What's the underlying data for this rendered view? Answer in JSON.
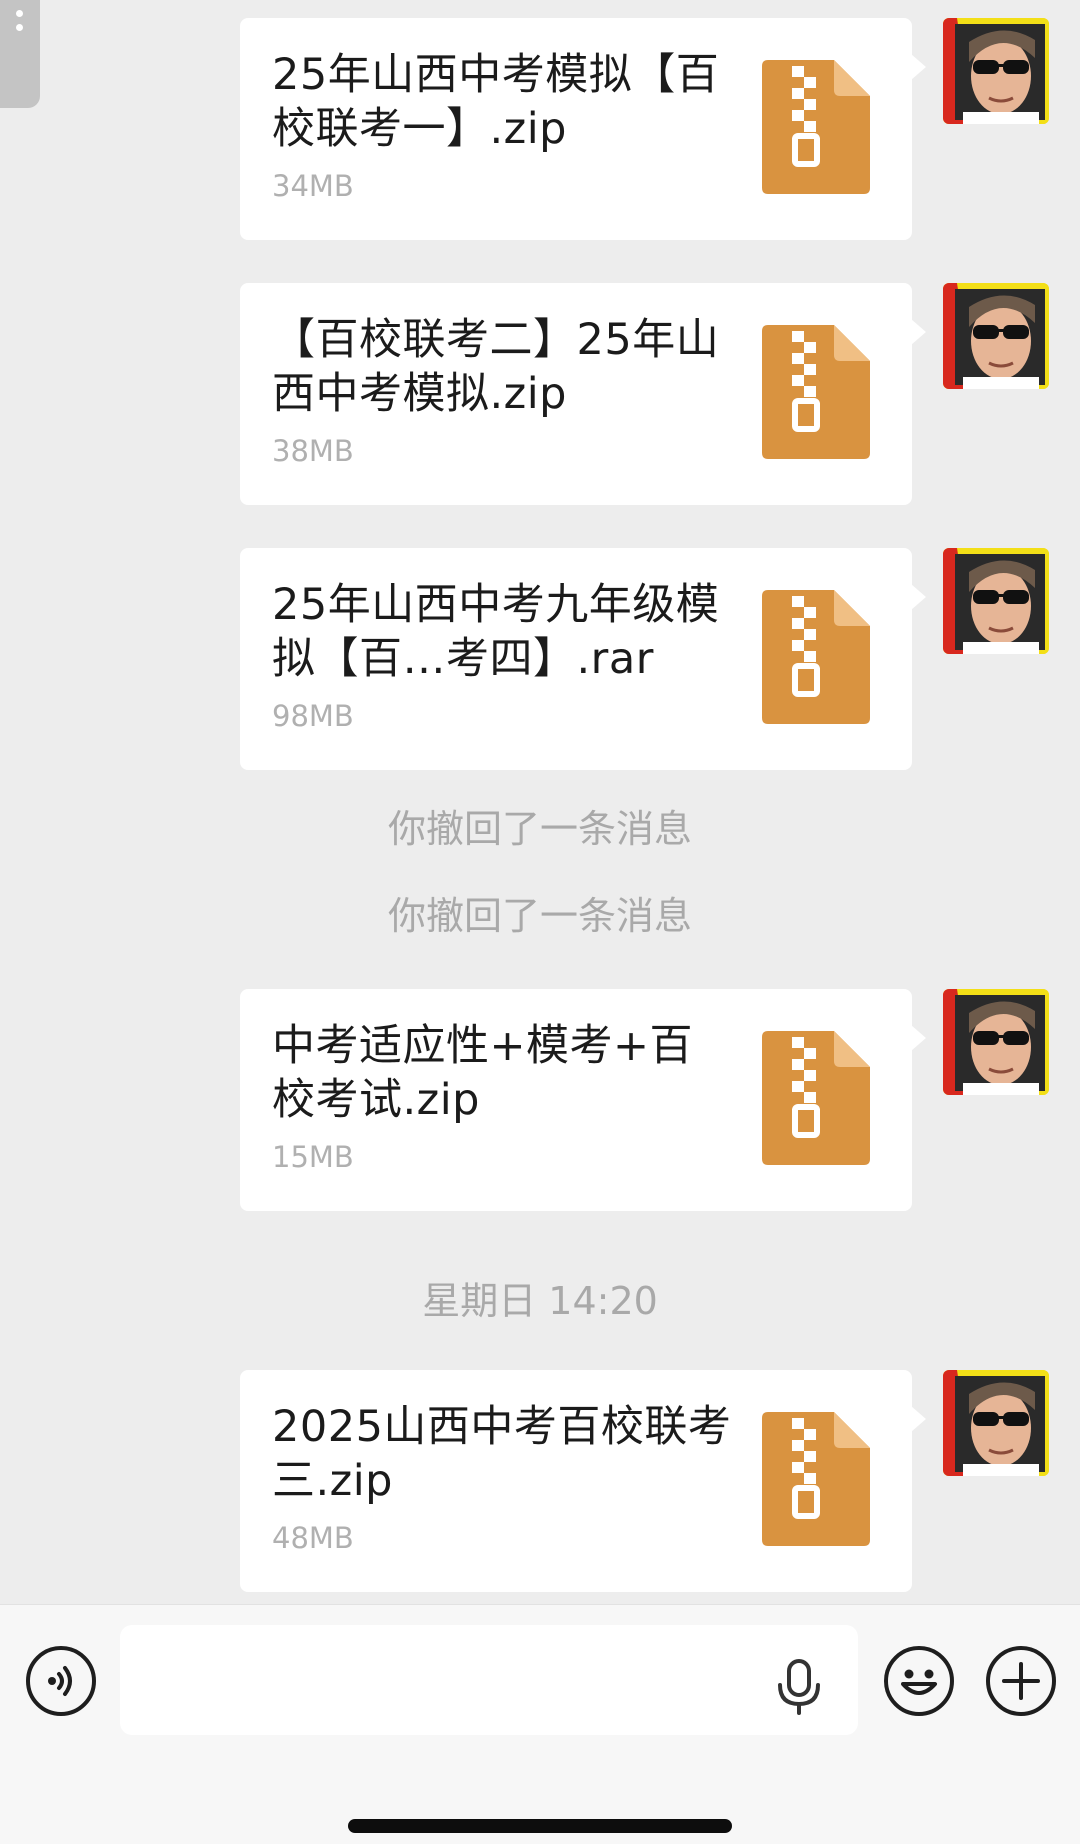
{
  "messages": [
    {
      "file_name": "25年山西中考模拟【百校联考一】.zip",
      "file_size": "34MB",
      "file_icon": "zip-file-icon"
    },
    {
      "file_name": "【百校联考二】25年山西中考模拟.zip",
      "file_size": "38MB",
      "file_icon": "zip-file-icon"
    },
    {
      "file_name": "25年山西中考九年级模拟【百…考四】.rar",
      "file_size": "98MB",
      "file_icon": "zip-file-icon"
    },
    {
      "file_name": "中考适应性+模考+百校考试.zip",
      "file_size": "15MB",
      "file_icon": "zip-file-icon"
    },
    {
      "file_name": "2025山西中考百校联考三.zip",
      "file_size": "48MB",
      "file_icon": "zip-file-icon"
    }
  ],
  "system_notes": {
    "recall_1": "你撤回了一条消息",
    "recall_2": "你撤回了一条消息",
    "timestamp": "星期日 14:20"
  },
  "input_bar": {
    "input_value": "",
    "left_icon": "voice-toggle-icon",
    "mic_icon": "microphone-icon",
    "emoji_icon": "emoji-icon",
    "plus_icon": "plus-icon"
  },
  "colors": {
    "background": "#ededed",
    "bubble": "#ffffff",
    "zip_icon": "#d99340",
    "secondary_text": "#b0b0b0"
  }
}
